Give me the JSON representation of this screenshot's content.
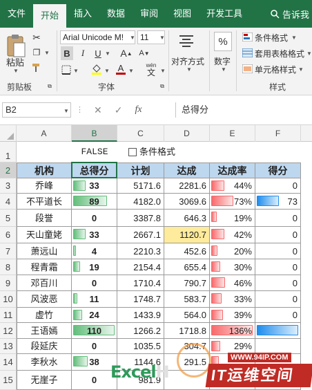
{
  "ribbon_tabs": [
    "文件",
    "开始",
    "插入",
    "数据",
    "审阅",
    "视图",
    "开发工具"
  ],
  "tell_me": "告诉我",
  "clipboard": {
    "paste": "粘贴",
    "group": "剪贴板"
  },
  "font": {
    "name": "Arial Unicode M!",
    "size": "11",
    "group": "字体",
    "bold": "B",
    "italic": "I",
    "underline": "U",
    "grow": "A",
    "shrink": "A",
    "color_a": "A",
    "phonetic": "wén"
  },
  "alignment": {
    "label": "对齐方式"
  },
  "number": {
    "label": "数字",
    "symbol": "%"
  },
  "styles": {
    "cond_format": "条件格式",
    "table_format": "套用表格格式",
    "cell_style": "单元格样式",
    "group": "样式"
  },
  "namebox": "B2",
  "formula": "总得分",
  "fx": "fx",
  "columns": [
    "A",
    "B",
    "C",
    "D",
    "E",
    "F"
  ],
  "rows": [
    "1",
    "2",
    "3",
    "4",
    "5",
    "6",
    "7",
    "8",
    "9",
    "10",
    "11",
    "12",
    "13",
    "14",
    "15"
  ],
  "row1": {
    "false_text": "FALSE",
    "checkbox_label": "条件格式"
  },
  "headers": [
    "机构",
    "总得分",
    "计划",
    "达成",
    "达成率",
    "得分"
  ],
  "table": [
    {
      "org": "乔峰",
      "score": "33",
      "score_v": 33,
      "plan": "5171.6",
      "done": "2281.6",
      "rate": "44%",
      "rate_v": 44,
      "pts": "0",
      "pts_v": 0
    },
    {
      "org": "不平道长",
      "score": "89",
      "score_v": 89,
      "plan": "4182.0",
      "done": "3069.6",
      "rate": "73%",
      "rate_v": 73,
      "pts": "73",
      "pts_v": 73
    },
    {
      "org": "段誉",
      "score": "0",
      "score_v": 0,
      "plan": "3387.8",
      "done": "646.3",
      "rate": "19%",
      "rate_v": 19,
      "pts": "0",
      "pts_v": 0
    },
    {
      "org": "天山童姥",
      "score": "33",
      "score_v": 33,
      "plan": "2667.1",
      "done": "1120.7",
      "rate": "42%",
      "rate_v": 42,
      "pts": "0",
      "pts_v": 0
    },
    {
      "org": "萧远山",
      "score": "4",
      "score_v": 4,
      "plan": "2210.3",
      "done": "452.6",
      "rate": "20%",
      "rate_v": 20,
      "pts": "0",
      "pts_v": 0
    },
    {
      "org": "程青霜",
      "score": "19",
      "score_v": 19,
      "plan": "2154.4",
      "done": "655.4",
      "rate": "30%",
      "rate_v": 30,
      "pts": "0",
      "pts_v": 0
    },
    {
      "org": "邓百川",
      "score": "0",
      "score_v": 0,
      "plan": "1710.4",
      "done": "790.7",
      "rate": "46%",
      "rate_v": 46,
      "pts": "0",
      "pts_v": 0
    },
    {
      "org": "风波恶",
      "score": "11",
      "score_v": 11,
      "plan": "1748.7",
      "done": "583.7",
      "rate": "33%",
      "rate_v": 33,
      "pts": "0",
      "pts_v": 0
    },
    {
      "org": "虚竹",
      "score": "24",
      "score_v": 24,
      "plan": "1433.9",
      "done": "564.0",
      "rate": "39%",
      "rate_v": 39,
      "pts": "0",
      "pts_v": 0
    },
    {
      "org": "王语嫣",
      "score": "110",
      "score_v": 110,
      "plan": "1266.2",
      "done": "1718.8",
      "rate": "136%",
      "rate_v": 136,
      "pts": "",
      "pts_v": 136
    },
    {
      "org": "段延庆",
      "score": "0",
      "score_v": 0,
      "plan": "1035.5",
      "done": "304.7",
      "rate": "29%",
      "rate_v": 29,
      "pts": "",
      "pts_v": 0
    },
    {
      "org": "李秋水",
      "score": "38",
      "score_v": 38,
      "plan": "1144.6",
      "done": "291.5",
      "rate": "",
      "rate_v": 25,
      "pts": "",
      "pts_v": 0
    },
    {
      "org": "无崖子",
      "score": "0",
      "score_v": 0,
      "plan": "981.9",
      "done": "",
      "rate": "",
      "rate_v": 0,
      "pts": "",
      "pts_v": 0
    }
  ],
  "watermark": {
    "logo_a": "Excel",
    "logo_b": "H",
    "url": "WWW.94IP.COM",
    "brand": "IT运维空间"
  }
}
